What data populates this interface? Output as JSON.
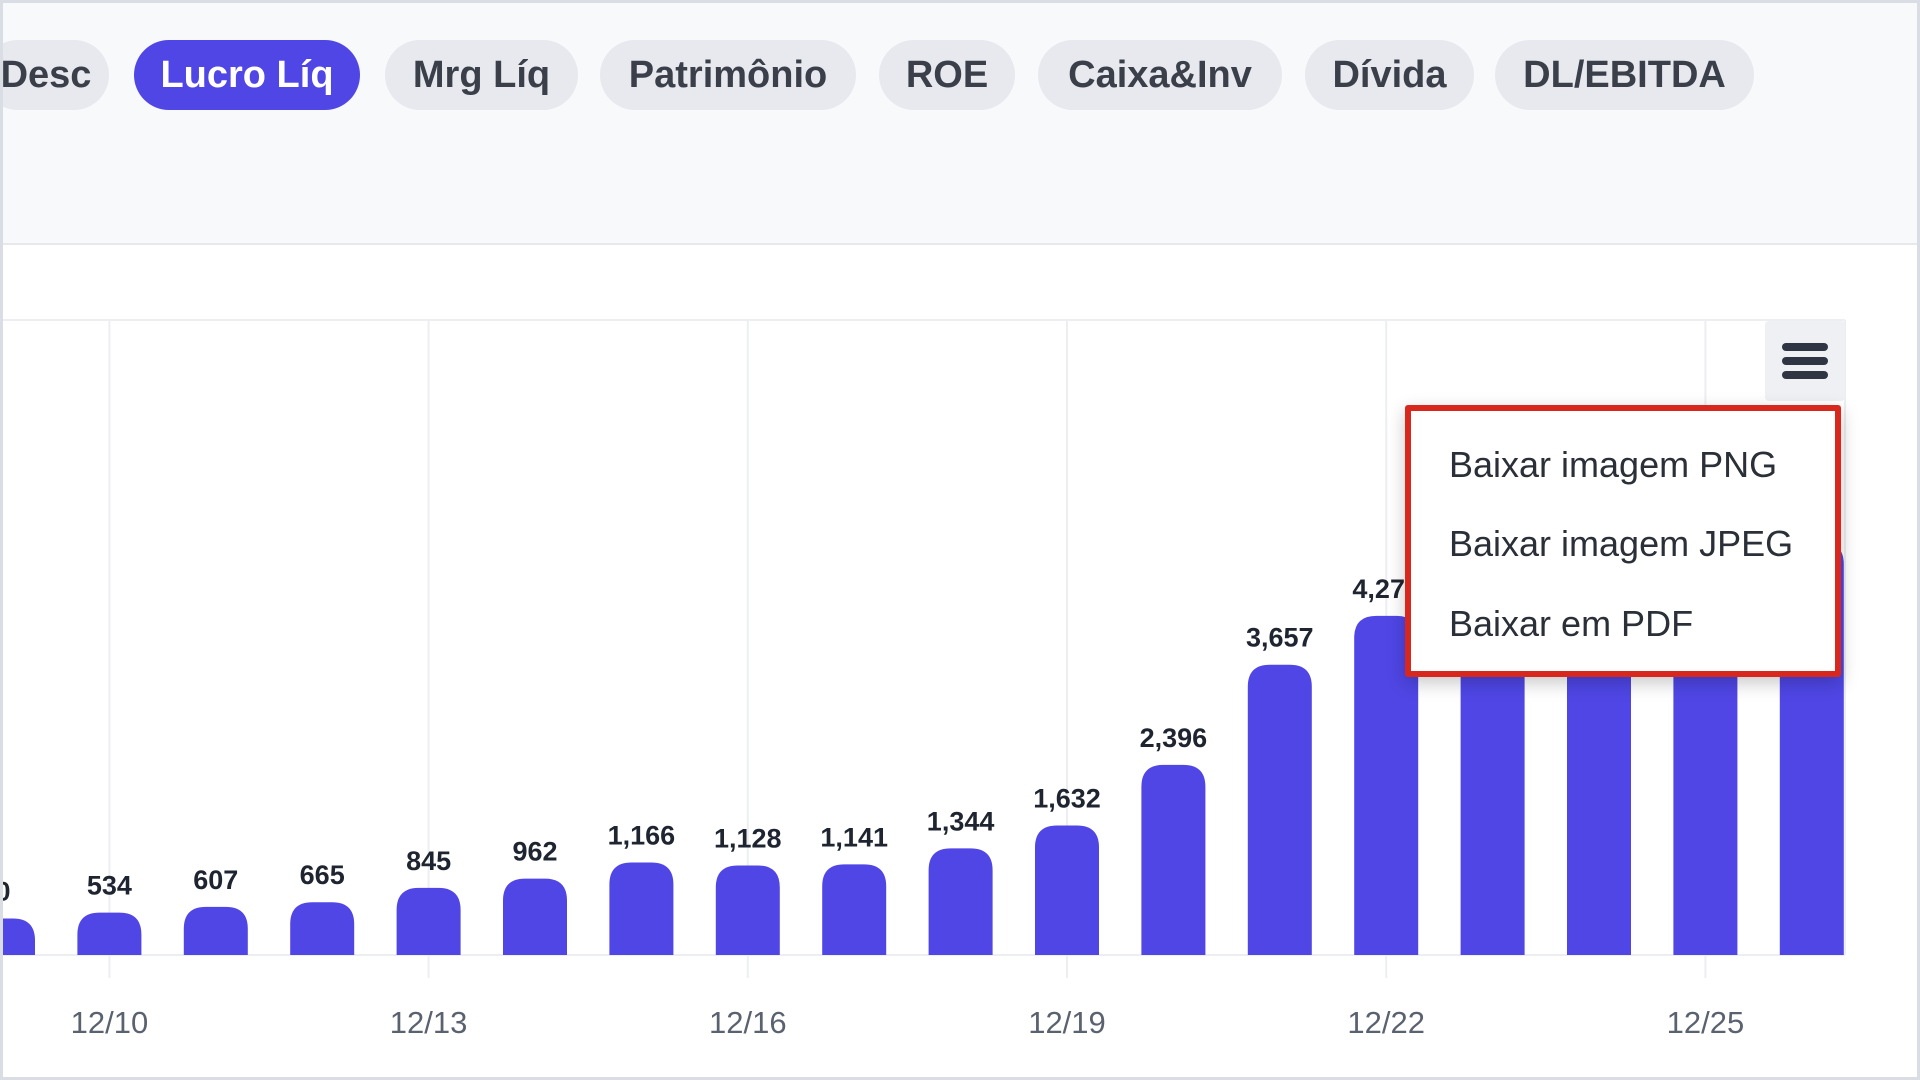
{
  "tabs": [
    {
      "label": "Desc",
      "active": false
    },
    {
      "label": "Lucro Líq",
      "active": true
    },
    {
      "label": "Mrg Líq",
      "active": false
    },
    {
      "label": "Patrimônio",
      "active": false
    },
    {
      "label": "ROE",
      "active": false
    },
    {
      "label": "Caixa&Inv",
      "active": false
    },
    {
      "label": "Dívida",
      "active": false
    },
    {
      "label": "DL/EBITDA",
      "active": false
    }
  ],
  "colors": {
    "accent": "#4f46e5",
    "active_tab_text": "#ffffff",
    "tab_bg": "#e7e9ef",
    "grid": "#eceef2",
    "axis_text": "#5a6270",
    "data_label": "#1f2530",
    "menu_highlight_border": "#d8281e"
  },
  "chart_menu": {
    "icon": "hamburger-menu-icon",
    "items": [
      "Baixar imagem PNG",
      "Baixar imagem JPEG",
      "Baixar em PDF"
    ]
  },
  "chart_data": {
    "type": "bar",
    "categories": [
      "12/09",
      "12/10",
      "12/11",
      "12/12",
      "12/13",
      "12/14",
      "12/15",
      "12/16",
      "12/17",
      "12/18",
      "12/19",
      "12/20",
      "12/21",
      "12/22",
      "12/23",
      "12/24",
      "12/25",
      "12/26"
    ],
    "tick_labels": [
      "12/10",
      "12/13",
      "12/16",
      "12/19",
      "12/22",
      "12/25"
    ],
    "values": [
      460,
      534,
      607,
      665,
      845,
      962,
      1166,
      1128,
      1141,
      1344,
      1632,
      2396,
      3657,
      4273,
      4600,
      4800,
      5000,
      5200
    ],
    "data_labels": [
      "0",
      "534",
      "607",
      "665",
      "845",
      "962",
      "1,166",
      "1,128",
      "1,141",
      "1,344",
      "1,632",
      "2,396",
      "3,657",
      "4,273",
      "",
      "",
      "",
      ""
    ],
    "series_color": "#4f46e5",
    "grid": true,
    "title": "",
    "xlabel": "",
    "ylabel": ""
  }
}
